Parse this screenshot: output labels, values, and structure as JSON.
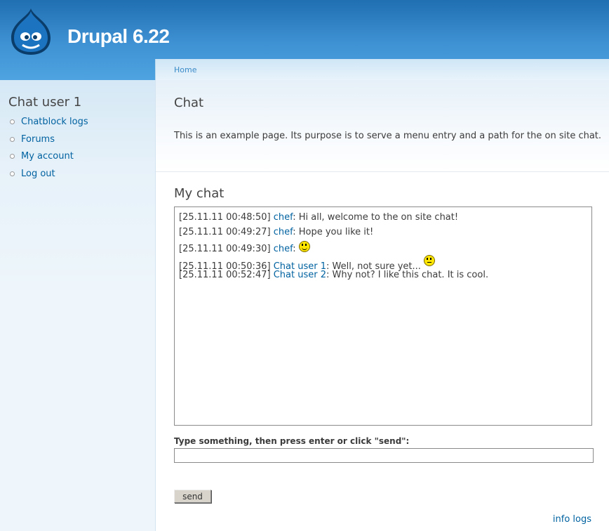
{
  "site": {
    "name": "Drupal 6.22"
  },
  "breadcrumb": {
    "home": "Home"
  },
  "sidebar": {
    "title": "Chat user 1",
    "items": [
      {
        "label": "Chatblock logs"
      },
      {
        "label": "Forums"
      },
      {
        "label": "My account"
      },
      {
        "label": "Log out"
      }
    ]
  },
  "main": {
    "page_title": "Chat",
    "intro": "This is an example page. Its purpose is to serve a menu entry and a path for the on site chat.",
    "chat_title": "My chat",
    "messages": [
      {
        "time": "[25.11.11 00:48:50]",
        "user": "chef",
        "text": "Hi all, welcome to the on site chat!"
      },
      {
        "time": "[25.11.11 00:49:27]",
        "user": "chef",
        "text": "Hope you like it!"
      },
      {
        "time": "[25.11.11 00:49:30]",
        "user": "chef",
        "text": "",
        "smiley": "happy"
      },
      {
        "time": "[25.11.11 00:50:36]",
        "user": "Chat user 1",
        "text": "Well, not sure yet...",
        "smiley": "unsure"
      },
      {
        "time": "[25.11.11 00:52:47]",
        "user": "Chat user 2",
        "text": "Why not? I like this chat. It is cool."
      }
    ],
    "input_label": "Type something, then press enter or click \"send\":",
    "input_value": "",
    "send_label": "send",
    "info_logs": "info logs"
  },
  "colors": {
    "link": "#0062a0",
    "header": "#2e80c4"
  }
}
